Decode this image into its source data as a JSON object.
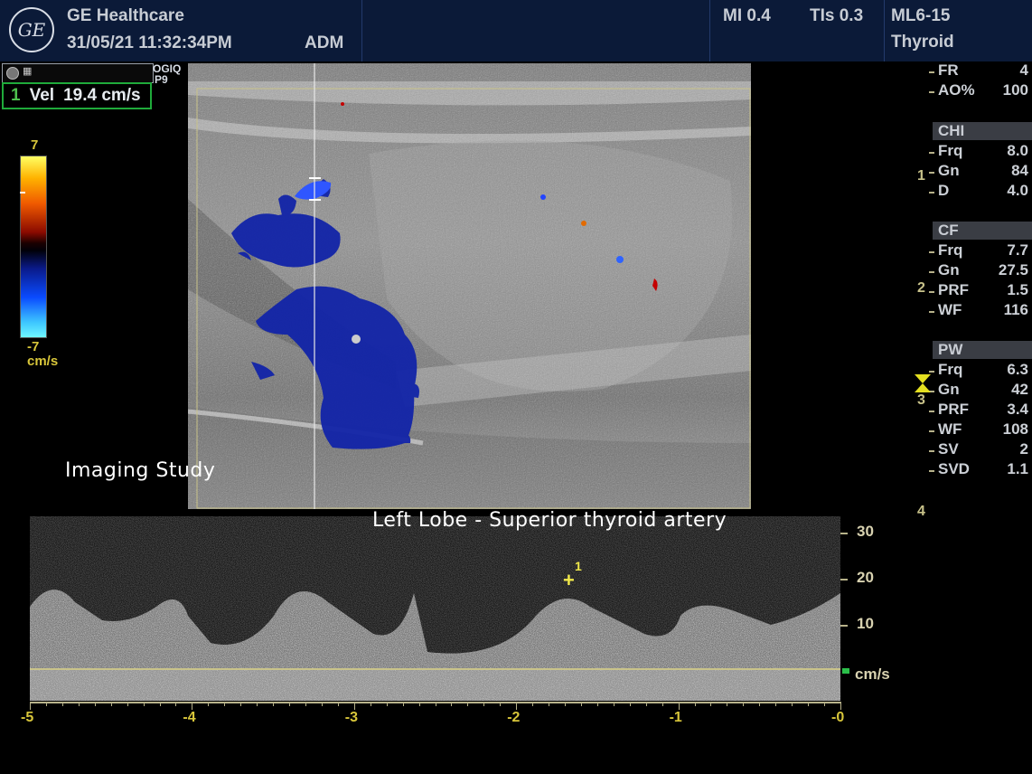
{
  "header": {
    "brand": "GE Healthcare",
    "datetime": "31/05/21 11:32:34PM",
    "user": "ADM",
    "mi": "MI 0.4",
    "tis": "TIs 0.3",
    "probe": "ML6-15",
    "preset": "Thyroid",
    "logo_text": "GE"
  },
  "left": {
    "vel_index": "1",
    "vel_label": "Vel",
    "vel_value": "19.4 cm/s",
    "system_tag_line1": "OGIQ",
    "system_tag_line2": "P9",
    "colorbar_max": "7",
    "colorbar_min": "-7",
    "colorbar_unit": "cm/s"
  },
  "annotations": {
    "study_label": "Imaging Study",
    "site_label": "Left Lobe - Superior thyroid artery",
    "caliper_label": "1"
  },
  "right_panel": {
    "top": [
      {
        "k": "FR",
        "v": "4"
      },
      {
        "k": "AO%",
        "v": "100"
      }
    ],
    "sections": [
      {
        "title": "CHI",
        "rows": [
          {
            "k": "Frq",
            "v": "8.0"
          },
          {
            "k": "Gn",
            "v": "84"
          },
          {
            "k": "D",
            "v": "4.0"
          }
        ]
      },
      {
        "title": "CF",
        "rows": [
          {
            "k": "Frq",
            "v": "7.7"
          },
          {
            "k": "Gn",
            "v": "27.5"
          },
          {
            "k": "PRF",
            "v": "1.5"
          },
          {
            "k": "WF",
            "v": "116"
          }
        ]
      },
      {
        "title": "PW",
        "rows": [
          {
            "k": "Frq",
            "v": "6.3"
          },
          {
            "k": "Gn",
            "v": "42"
          },
          {
            "k": "PRF",
            "v": "3.4"
          },
          {
            "k": "WF",
            "v": "108"
          },
          {
            "k": "SV",
            "v": "2"
          },
          {
            "k": "SVD",
            "v": "1.1"
          }
        ]
      }
    ],
    "depth_marks": [
      "1",
      "2",
      "3",
      "4"
    ]
  },
  "doppler_axis": {
    "velocity_ticks": [
      "30",
      "20",
      "10"
    ],
    "velocity_unit": "cm/s",
    "time_ticks": [
      "-5",
      "-4",
      "-3",
      "-2",
      "-1",
      "-0"
    ]
  },
  "colors": {
    "header_bg": "#0b1a38",
    "accent_yellow": "#d8c63a",
    "vel_box_border": "#1faa3a",
    "flow_blue": "#0e1fa6"
  }
}
